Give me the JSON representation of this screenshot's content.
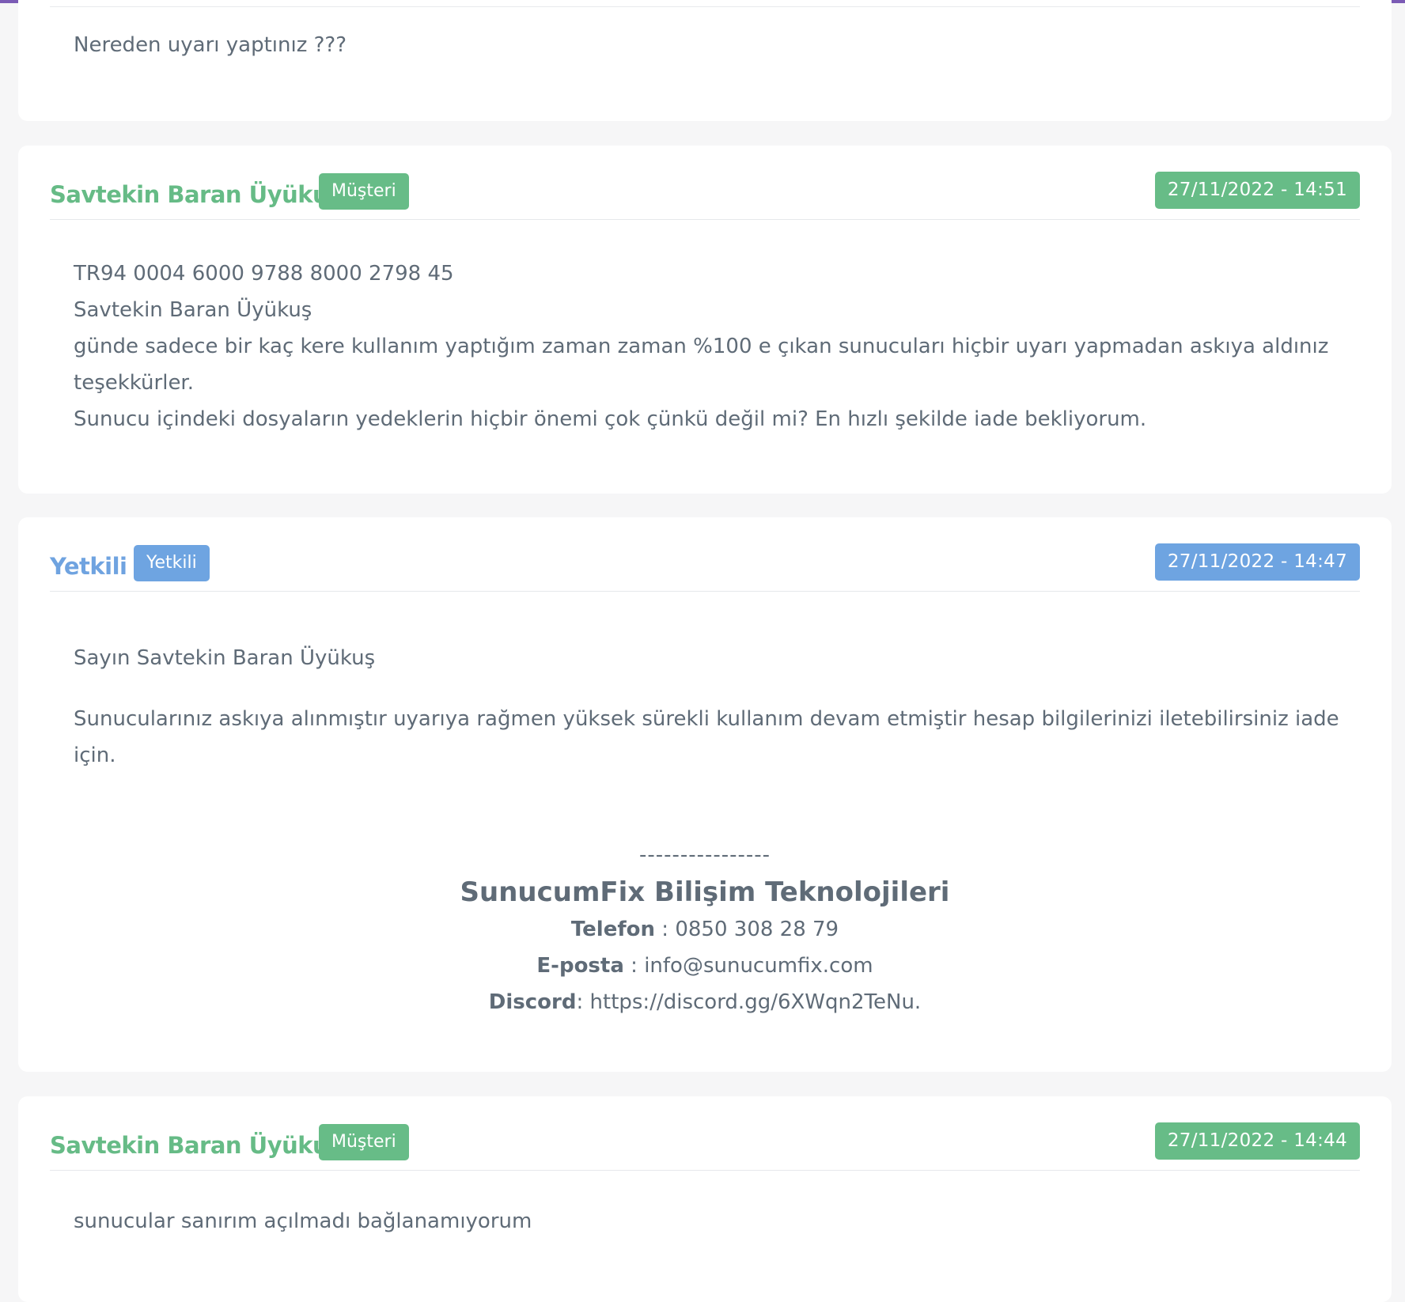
{
  "messages": [
    {
      "body": [
        "Nereden uyarı yaptınız ???"
      ]
    },
    {
      "author": "Savtekin Baran Üyükuş",
      "role": "Müşteri",
      "date": "27/11/2022 - 14:51",
      "body": [
        "TR94 0004 6000 9788 8000 2798 45",
        "Savtekin Baran Üyükuş",
        "günde sadece bir kaç kere kullanım yaptığım zaman zaman %100 e çıkan sunucuları hiçbir uyarı yapmadan askıya aldınız teşekkürler.",
        "Sunucu içindeki dosyaların yedeklerin hiçbir önemi çok çünkü değil mi? En hızlı şekilde iade bekliyorum."
      ]
    },
    {
      "author": "Yetkili",
      "role": "Yetkili",
      "date": "27/11/2022 - 14:47",
      "greeting": "Sayın Savtekin Baran Üyükuş",
      "message": "Sunucularınız askıya alınmıştır uyarıya rağmen yüksek sürekli kullanım devam etmiştir hesap bilgilerinizi iletebilirsiniz iade için.",
      "signature": {
        "dashes": "----------------",
        "company": "SunucumFix Bilişim Teknolojileri",
        "phone_label": "Telefon",
        "phone_sep": " : ",
        "phone": "0850 308 28 79",
        "email_label": "E-posta",
        "email_sep": " : ",
        "email": "info@sunucumfix.com",
        "discord_label": "Discord",
        "discord_sep": ": ",
        "discord": "https://discord.gg/6XWqn2TeNu."
      }
    },
    {
      "author": "Savtekin Baran Üyükuş",
      "role": "Müşteri",
      "date": "27/11/2022 - 14:44",
      "body": [
        "sunucular sanırım açılmadı bağlanamıyorum"
      ]
    }
  ],
  "colors": {
    "customer": "#67bc87",
    "staff": "#6ea4e1",
    "accent": "#7b5bb5",
    "text": "#5f6b77",
    "background": "#f6f6f7"
  }
}
